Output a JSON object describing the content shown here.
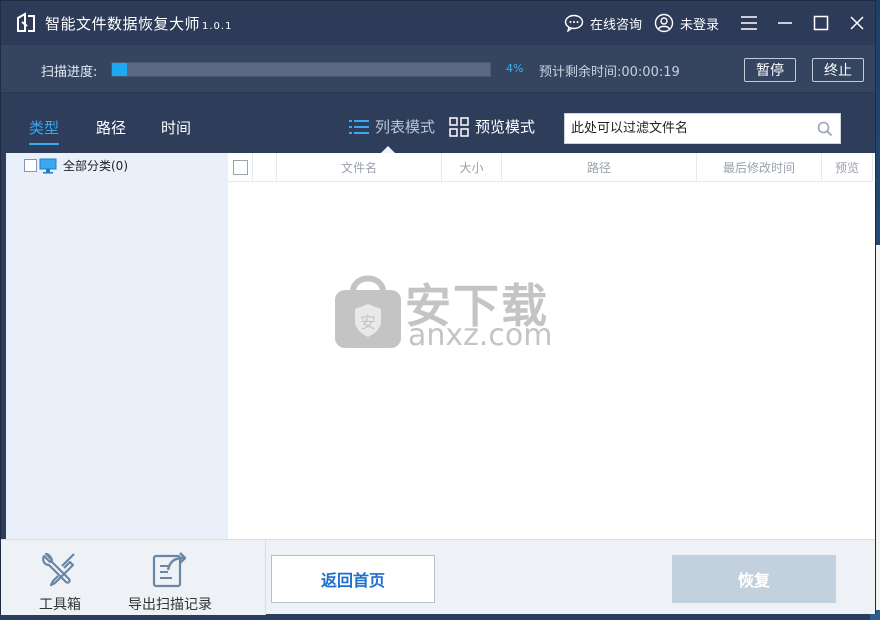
{
  "titlebar": {
    "title": "智能文件数据恢复大师",
    "version": "1.0.1",
    "consult_label": "在线咨询",
    "login_label": "未登录"
  },
  "progress": {
    "label": "扫描进度:",
    "percent_text": "4%",
    "percent_value": 0.04,
    "remaining_text": "预计剩余时间:00:00:19",
    "pause_label": "暂停",
    "stop_label": "终止"
  },
  "tabs": [
    {
      "label": "类型",
      "active": true
    },
    {
      "label": "路径",
      "active": false
    },
    {
      "label": "时间",
      "active": false
    }
  ],
  "modes": {
    "list_label": "列表模式",
    "preview_label": "预览模式"
  },
  "filter": {
    "placeholder": "此处可以过滤文件名"
  },
  "tree": {
    "all_label": "全部分类(0)"
  },
  "table": {
    "columns": [
      "文件名",
      "大小",
      "路径",
      "最后修改时间",
      "预览"
    ]
  },
  "watermark": {
    "main": "安下载",
    "sub": "anxz.com"
  },
  "bottom": {
    "toolbox_label": "工具箱",
    "export_label": "导出扫描记录",
    "home_label": "返回首页",
    "recover_label": "恢复"
  },
  "colors": {
    "accent": "#3aa7ef",
    "progress_fill": "#1ea8f2",
    "header_bg": "#2e3d5a",
    "recover_disabled": "#c3d0de"
  }
}
